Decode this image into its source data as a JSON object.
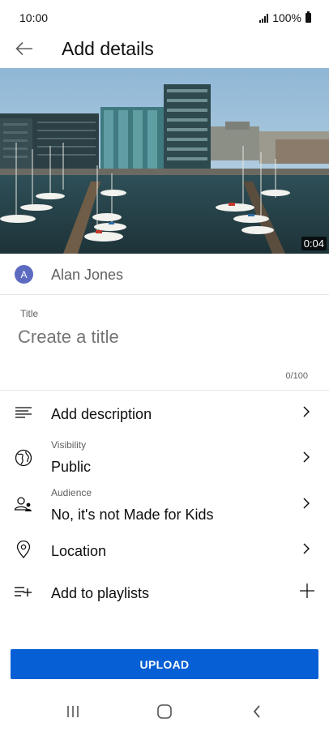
{
  "status_bar": {
    "time": "10:00",
    "battery": "100%"
  },
  "header": {
    "title": "Add details"
  },
  "video": {
    "duration": "0:04"
  },
  "channel": {
    "avatar_letter": "A",
    "name": "Alan Jones",
    "avatar_color": "#5c6bc0"
  },
  "title_field": {
    "label": "Title",
    "placeholder": "Create a title",
    "value": "",
    "counter": "0/100"
  },
  "menu": {
    "description": {
      "label": "Add description",
      "icon": "description-icon"
    },
    "visibility": {
      "sublabel": "Visibility",
      "value": "Public",
      "icon": "globe-icon"
    },
    "audience": {
      "sublabel": "Audience",
      "value": "No, it's not Made for Kids",
      "icon": "audience-icon"
    },
    "location": {
      "label": "Location",
      "icon": "location-pin-icon"
    },
    "playlists": {
      "label": "Add to playlists",
      "icon": "add-playlist-icon"
    }
  },
  "upload": {
    "label": "UPLOAD",
    "color": "#065fd4"
  },
  "nav": {
    "recents": "recents-icon",
    "home": "home-icon",
    "back": "back-icon"
  }
}
